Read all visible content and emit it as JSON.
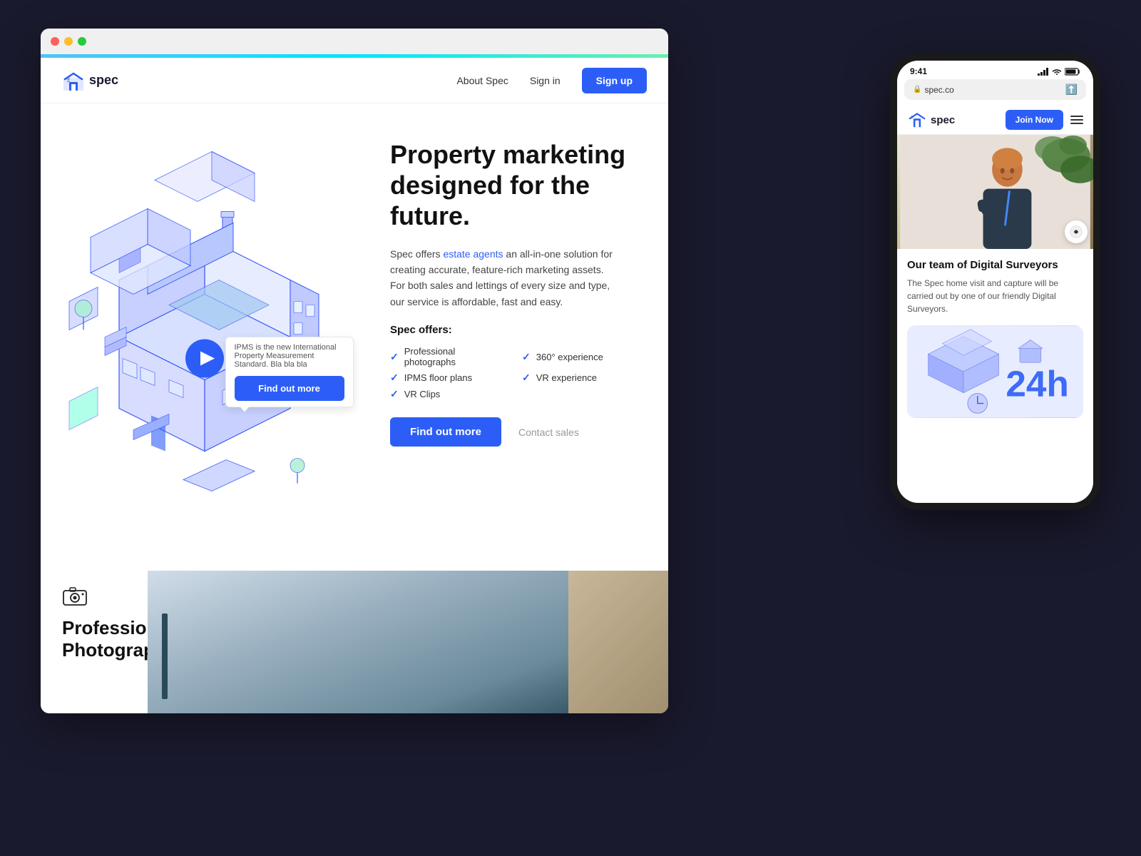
{
  "background": "#1a1a2e",
  "desktop": {
    "logo": {
      "text": "spec",
      "icon": "home-icon"
    },
    "nav": {
      "links": [
        "About Spec",
        "Sign in"
      ],
      "cta": "Sign up"
    },
    "hero": {
      "title": "Property marketing designed for the future.",
      "description_parts": [
        "Spec offers ",
        "estate agents",
        " an all-in-one solution for creating accurate, feature-rich marketing assets. For both sales and lettings of every size and type, our service is affordable, fast and easy."
      ],
      "offers_label": "Spec offers:",
      "offers": [
        "Professional photographs",
        "360° experience",
        "IPMS floor plans",
        "VR experience",
        "",
        "VR Clips"
      ],
      "cta_primary": "Find out more",
      "cta_secondary": "Contact sales",
      "tooltip": "IPMS is the new International Property Measurement Standard. Bla bla bla"
    },
    "bottom": {
      "section_icon": "camera-icon",
      "section_title_line1": "Professional",
      "section_title_line2": "Photography"
    }
  },
  "mobile": {
    "status": {
      "time": "9:41",
      "url": "spec.co"
    },
    "logo": {
      "text": "spec",
      "icon": "home-icon"
    },
    "nav": {
      "cta": "Join Now",
      "menu": "hamburger-icon"
    },
    "surveyor_section": {
      "title": "Our team of Digital Surveyors",
      "description": "The Spec home visit and capture will be carried out by one of our friendly Digital Surveyors."
    },
    "illustration_label": "24h"
  }
}
